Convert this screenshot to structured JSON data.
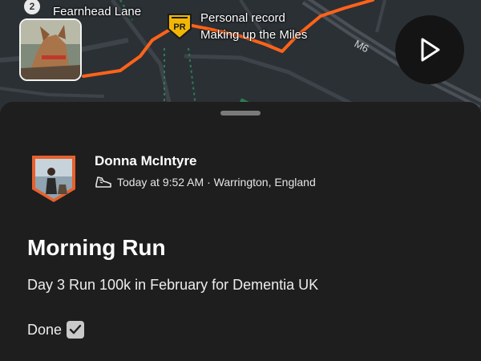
{
  "map": {
    "route_color": "#ff6319",
    "labels": {
      "lane": "Fearnhead Lane",
      "pr_line1": "Personal record",
      "pr_line2": "Making up the Miles",
      "road": "M6"
    },
    "photo_badge": "2",
    "pr_badge": "PR",
    "pr_badge_color": "#f2b705",
    "play_icon": "play-icon"
  },
  "athlete": {
    "name": "Donna McIntyre",
    "meta_icon": "running-shoe-icon",
    "meta": "Today at 9:52 AM · Warrington, England"
  },
  "activity": {
    "title": "Morning Run",
    "description": "Day 3 Run 100k in February for Dementia UK",
    "done_label": "Done",
    "done_icon": "checkbox-checked-icon"
  }
}
